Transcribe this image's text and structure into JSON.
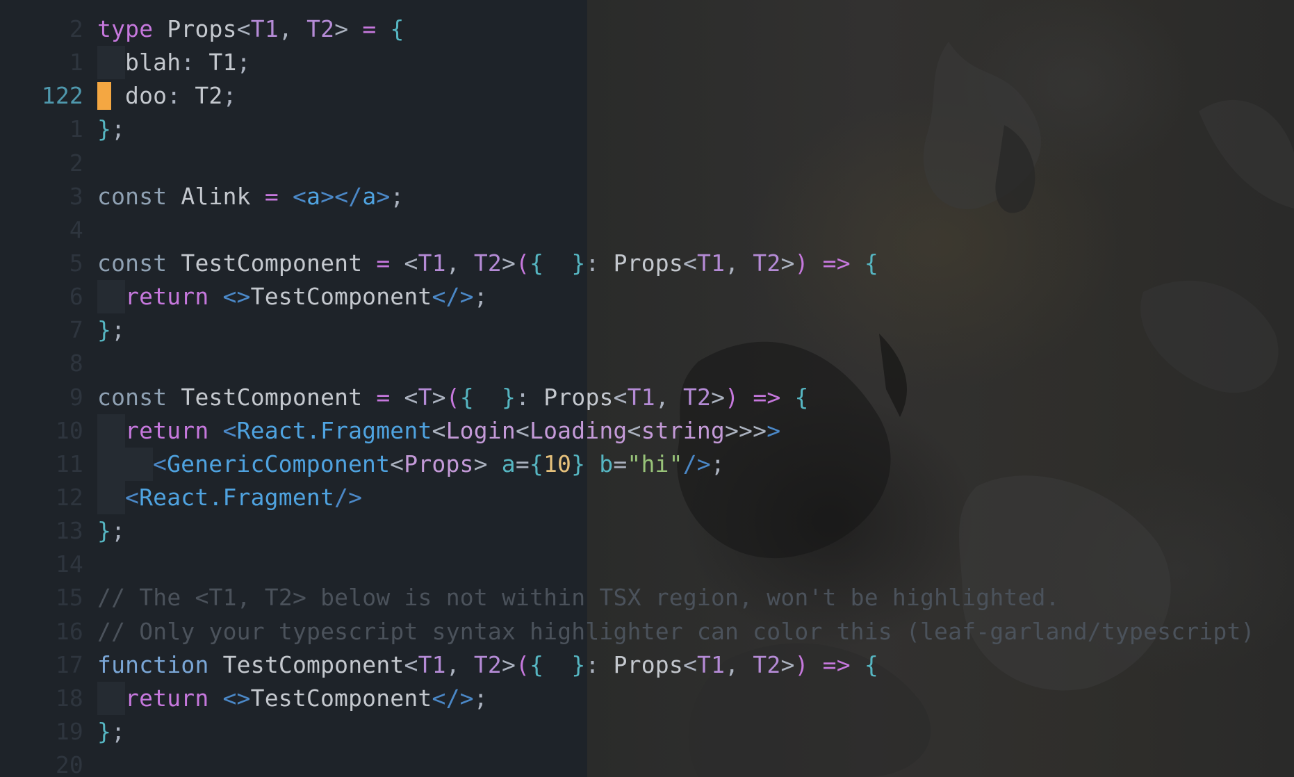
{
  "editor": {
    "lines": [
      {
        "number": "2",
        "current": false,
        "indent": 0,
        "cursor": false,
        "tokens": [
          {
            "t": "type",
            "c": "kw"
          },
          {
            "t": " ",
            "c": "txt"
          },
          {
            "t": "Props",
            "c": "txt"
          },
          {
            "t": "<",
            "c": "pn"
          },
          {
            "t": "T1",
            "c": "tp"
          },
          {
            "t": ", ",
            "c": "pn"
          },
          {
            "t": "T2",
            "c": "tp"
          },
          {
            "t": ">",
            "c": "pn"
          },
          {
            "t": " = ",
            "c": "op"
          },
          {
            "t": "{",
            "c": "br"
          }
        ]
      },
      {
        "number": "1",
        "current": false,
        "indent": 1,
        "cursor": false,
        "tokens": [
          {
            "t": "blah",
            "c": "txt"
          },
          {
            "t": ": ",
            "c": "pn"
          },
          {
            "t": "T1",
            "c": "txt"
          },
          {
            "t": ";",
            "c": "pn"
          }
        ]
      },
      {
        "number": "122",
        "current": true,
        "indent": 0,
        "cursor": true,
        "tokens": [
          {
            "t": "doo",
            "c": "txt"
          },
          {
            "t": ": ",
            "c": "pn"
          },
          {
            "t": "T2",
            "c": "txt"
          },
          {
            "t": ";",
            "c": "pn"
          }
        ]
      },
      {
        "number": "1",
        "current": false,
        "indent": 0,
        "cursor": false,
        "tokens": [
          {
            "t": "}",
            "c": "br"
          },
          {
            "t": ";",
            "c": "pn"
          }
        ]
      },
      {
        "number": "2",
        "current": false,
        "indent": 0,
        "cursor": false,
        "tokens": []
      },
      {
        "number": "3",
        "current": false,
        "indent": 0,
        "cursor": false,
        "tokens": [
          {
            "t": "const",
            "c": "kw2"
          },
          {
            "t": " Alink ",
            "c": "txt"
          },
          {
            "t": "=",
            "c": "op"
          },
          {
            "t": " ",
            "c": "txt"
          },
          {
            "t": "<",
            "c": "tagb"
          },
          {
            "t": "a",
            "c": "tag"
          },
          {
            "t": "></",
            "c": "tagb"
          },
          {
            "t": "a",
            "c": "tag"
          },
          {
            "t": ">",
            "c": "tagb"
          },
          {
            "t": ";",
            "c": "pn"
          }
        ]
      },
      {
        "number": "4",
        "current": false,
        "indent": 0,
        "cursor": false,
        "tokens": []
      },
      {
        "number": "5",
        "current": false,
        "indent": 0,
        "cursor": false,
        "tokens": [
          {
            "t": "const",
            "c": "kw2"
          },
          {
            "t": " TestComponent ",
            "c": "txt"
          },
          {
            "t": "=",
            "c": "op"
          },
          {
            "t": " <",
            "c": "pn"
          },
          {
            "t": "T1",
            "c": "tp"
          },
          {
            "t": ", ",
            "c": "pn"
          },
          {
            "t": "T2",
            "c": "tp"
          },
          {
            "t": ">",
            "c": "pn"
          },
          {
            "t": "(",
            "c": "op"
          },
          {
            "t": "{",
            "c": "br"
          },
          {
            "t": "  ",
            "c": "txt"
          },
          {
            "t": "}",
            "c": "br"
          },
          {
            "t": ": ",
            "c": "pn"
          },
          {
            "t": "Props",
            "c": "txt"
          },
          {
            "t": "<",
            "c": "pn"
          },
          {
            "t": "T1",
            "c": "tp"
          },
          {
            "t": ", ",
            "c": "pn"
          },
          {
            "t": "T2",
            "c": "tp"
          },
          {
            "t": ">",
            "c": "pn"
          },
          {
            "t": ")",
            "c": "op"
          },
          {
            "t": " => ",
            "c": "op"
          },
          {
            "t": "{",
            "c": "br"
          }
        ]
      },
      {
        "number": "6",
        "current": false,
        "indent": 1,
        "cursor": false,
        "tokens": [
          {
            "t": "return",
            "c": "kw"
          },
          {
            "t": " ",
            "c": "txt"
          },
          {
            "t": "<>",
            "c": "tagb"
          },
          {
            "t": "TestComponent",
            "c": "txt"
          },
          {
            "t": "</>",
            "c": "tagb"
          },
          {
            "t": ";",
            "c": "pn"
          }
        ]
      },
      {
        "number": "7",
        "current": false,
        "indent": 0,
        "cursor": false,
        "tokens": [
          {
            "t": "}",
            "c": "br"
          },
          {
            "t": ";",
            "c": "pn"
          }
        ]
      },
      {
        "number": "8",
        "current": false,
        "indent": 0,
        "cursor": false,
        "tokens": []
      },
      {
        "number": "9",
        "current": false,
        "indent": 0,
        "cursor": false,
        "tokens": [
          {
            "t": "const",
            "c": "kw2"
          },
          {
            "t": " TestComponent ",
            "c": "txt"
          },
          {
            "t": "=",
            "c": "op"
          },
          {
            "t": " <",
            "c": "pn"
          },
          {
            "t": "T",
            "c": "tp"
          },
          {
            "t": ">",
            "c": "pn"
          },
          {
            "t": "(",
            "c": "op"
          },
          {
            "t": "{",
            "c": "br"
          },
          {
            "t": "  ",
            "c": "txt"
          },
          {
            "t": "}",
            "c": "br"
          },
          {
            "t": ": ",
            "c": "pn"
          },
          {
            "t": "Props",
            "c": "txt"
          },
          {
            "t": "<",
            "c": "pn"
          },
          {
            "t": "T1",
            "c": "tp"
          },
          {
            "t": ", ",
            "c": "pn"
          },
          {
            "t": "T2",
            "c": "tp"
          },
          {
            "t": ">",
            "c": "pn"
          },
          {
            "t": ")",
            "c": "op"
          },
          {
            "t": " => ",
            "c": "op"
          },
          {
            "t": "{",
            "c": "br"
          }
        ]
      },
      {
        "number": "10",
        "current": false,
        "indent": 1,
        "cursor": false,
        "tokens": [
          {
            "t": "return",
            "c": "kw"
          },
          {
            "t": " ",
            "c": "txt"
          },
          {
            "t": "<",
            "c": "tagb"
          },
          {
            "t": "React.Fragment",
            "c": "tag"
          },
          {
            "t": "<",
            "c": "pn"
          },
          {
            "t": "Login",
            "c": "gen"
          },
          {
            "t": "<",
            "c": "pn"
          },
          {
            "t": "Loading",
            "c": "gen"
          },
          {
            "t": "<",
            "c": "pn"
          },
          {
            "t": "string",
            "c": "gen"
          },
          {
            "t": ">>>",
            "c": "pn"
          },
          {
            "t": ">",
            "c": "tagb"
          }
        ]
      },
      {
        "number": "11",
        "current": false,
        "indent": 2,
        "cursor": false,
        "tokens": [
          {
            "t": "<",
            "c": "tagb"
          },
          {
            "t": "GenericComponent",
            "c": "tag"
          },
          {
            "t": "<",
            "c": "pn"
          },
          {
            "t": "Props",
            "c": "gen"
          },
          {
            "t": ">",
            "c": "pn"
          },
          {
            "t": " a",
            "c": "attr"
          },
          {
            "t": "=",
            "c": "pn"
          },
          {
            "t": "{",
            "c": "br"
          },
          {
            "t": "10",
            "c": "num"
          },
          {
            "t": "}",
            "c": "br"
          },
          {
            "t": " b",
            "c": "attr"
          },
          {
            "t": "=",
            "c": "pn"
          },
          {
            "t": "\"hi\"",
            "c": "str"
          },
          {
            "t": "/>",
            "c": "tagb"
          },
          {
            "t": ";",
            "c": "pn"
          }
        ]
      },
      {
        "number": "12",
        "current": false,
        "indent": 1,
        "cursor": false,
        "tokens": [
          {
            "t": "<",
            "c": "tagb"
          },
          {
            "t": "React.Fragment",
            "c": "tag"
          },
          {
            "t": "/>",
            "c": "tagb"
          }
        ]
      },
      {
        "number": "13",
        "current": false,
        "indent": 0,
        "cursor": false,
        "tokens": [
          {
            "t": "}",
            "c": "br"
          },
          {
            "t": ";",
            "c": "pn"
          }
        ]
      },
      {
        "number": "14",
        "current": false,
        "indent": 0,
        "cursor": false,
        "tokens": []
      },
      {
        "number": "15",
        "current": false,
        "indent": 0,
        "cursor": false,
        "tokens": [
          {
            "t": "// The <T1, T2> below is not within TSX region, won't be highlighted.",
            "c": "cm"
          }
        ]
      },
      {
        "number": "16",
        "current": false,
        "indent": 0,
        "cursor": false,
        "tokens": [
          {
            "t": "// Only your typescript syntax highlighter can color this (leaf-garland/typescript)",
            "c": "cm"
          }
        ]
      },
      {
        "number": "17",
        "current": false,
        "indent": 0,
        "cursor": false,
        "tokens": [
          {
            "t": "function",
            "c": "fn"
          },
          {
            "t": " TestComponent",
            "c": "txt"
          },
          {
            "t": "<",
            "c": "pn"
          },
          {
            "t": "T1",
            "c": "tp"
          },
          {
            "t": ", ",
            "c": "pn"
          },
          {
            "t": "T2",
            "c": "tp"
          },
          {
            "t": ">",
            "c": "pn"
          },
          {
            "t": "(",
            "c": "op"
          },
          {
            "t": "{",
            "c": "br"
          },
          {
            "t": "  ",
            "c": "txt"
          },
          {
            "t": "}",
            "c": "br"
          },
          {
            "t": ": ",
            "c": "pn"
          },
          {
            "t": "Props",
            "c": "txt"
          },
          {
            "t": "<",
            "c": "pn"
          },
          {
            "t": "T1",
            "c": "tp"
          },
          {
            "t": ", ",
            "c": "pn"
          },
          {
            "t": "T2",
            "c": "tp"
          },
          {
            "t": ">",
            "c": "pn"
          },
          {
            "t": ")",
            "c": "op"
          },
          {
            "t": " => ",
            "c": "op"
          },
          {
            "t": "{",
            "c": "br"
          }
        ]
      },
      {
        "number": "18",
        "current": false,
        "indent": 1,
        "cursor": false,
        "tokens": [
          {
            "t": "return",
            "c": "kw"
          },
          {
            "t": " ",
            "c": "txt"
          },
          {
            "t": "<>",
            "c": "tagb"
          },
          {
            "t": "TestComponent",
            "c": "txt"
          },
          {
            "t": "</>",
            "c": "tagb"
          },
          {
            "t": ";",
            "c": "pn"
          }
        ]
      },
      {
        "number": "19",
        "current": false,
        "indent": 0,
        "cursor": false,
        "tokens": [
          {
            "t": "}",
            "c": "br"
          },
          {
            "t": ";",
            "c": "pn"
          }
        ]
      },
      {
        "number": "20",
        "current": false,
        "indent": 0,
        "cursor": false,
        "tokens": []
      }
    ]
  },
  "colors": {
    "background": "#1e2329",
    "cursor": "#f4a742",
    "current_line_number": "#4f98ad"
  }
}
